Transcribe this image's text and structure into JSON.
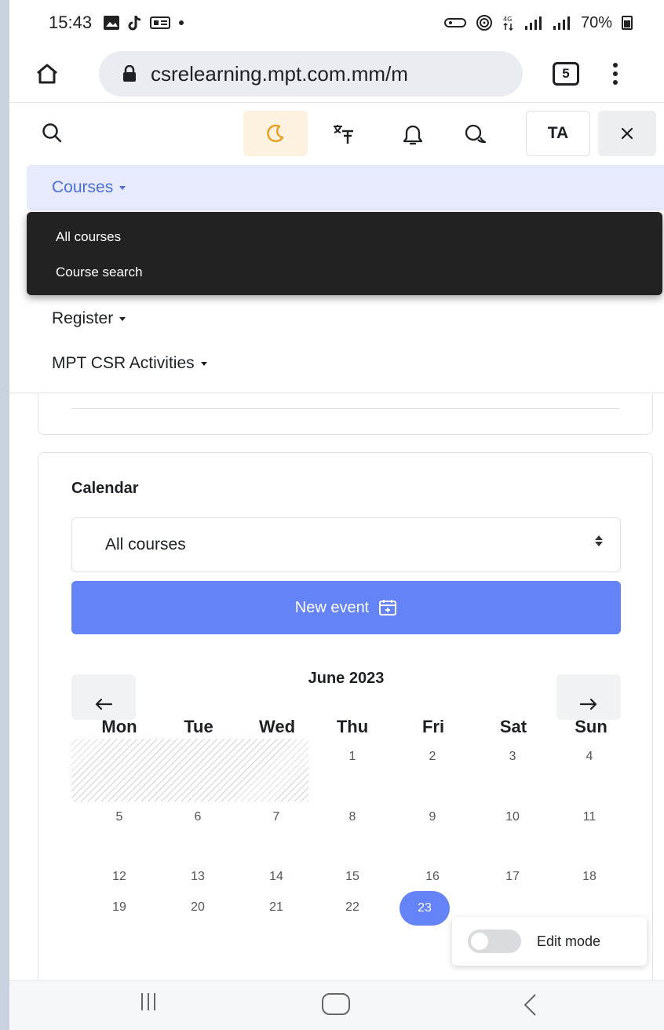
{
  "status_bar": {
    "time": "15:43",
    "battery": "70%"
  },
  "browser": {
    "url": "csrelearning.mpt.com.mm/m",
    "tab_count": "5"
  },
  "top_nav": {
    "avatar_initials": "TA"
  },
  "drawer": {
    "courses_label": "Courses",
    "dropdown_items": [
      "All courses",
      "Course search"
    ],
    "register_label": "Register",
    "mpt_label": "MPT CSR Activities"
  },
  "calendar": {
    "title": "Calendar",
    "course_filter": "All courses",
    "new_event_label": "New event",
    "month_label": "June 2023",
    "weekdays": [
      "Mon",
      "Tue",
      "Wed",
      "Thu",
      "Fri",
      "Sat",
      "Sun"
    ],
    "weeks": [
      [
        "",
        "",
        "",
        "1",
        "2",
        "3",
        "4"
      ],
      [
        "5",
        "6",
        "7",
        "8",
        "9",
        "10",
        "11"
      ],
      [
        "12",
        "13",
        "14",
        "15",
        "16",
        "17",
        "18"
      ],
      [
        "19",
        "20",
        "21",
        "22",
        "23",
        "",
        ""
      ]
    ],
    "today": "23"
  },
  "edit_mode": {
    "label": "Edit mode",
    "enabled": false
  },
  "colors": {
    "accent": "#6383f7",
    "courses_bg": "#e6eafa",
    "dropdown_bg": "#222222",
    "moon_bg": "#fdf2e0"
  }
}
